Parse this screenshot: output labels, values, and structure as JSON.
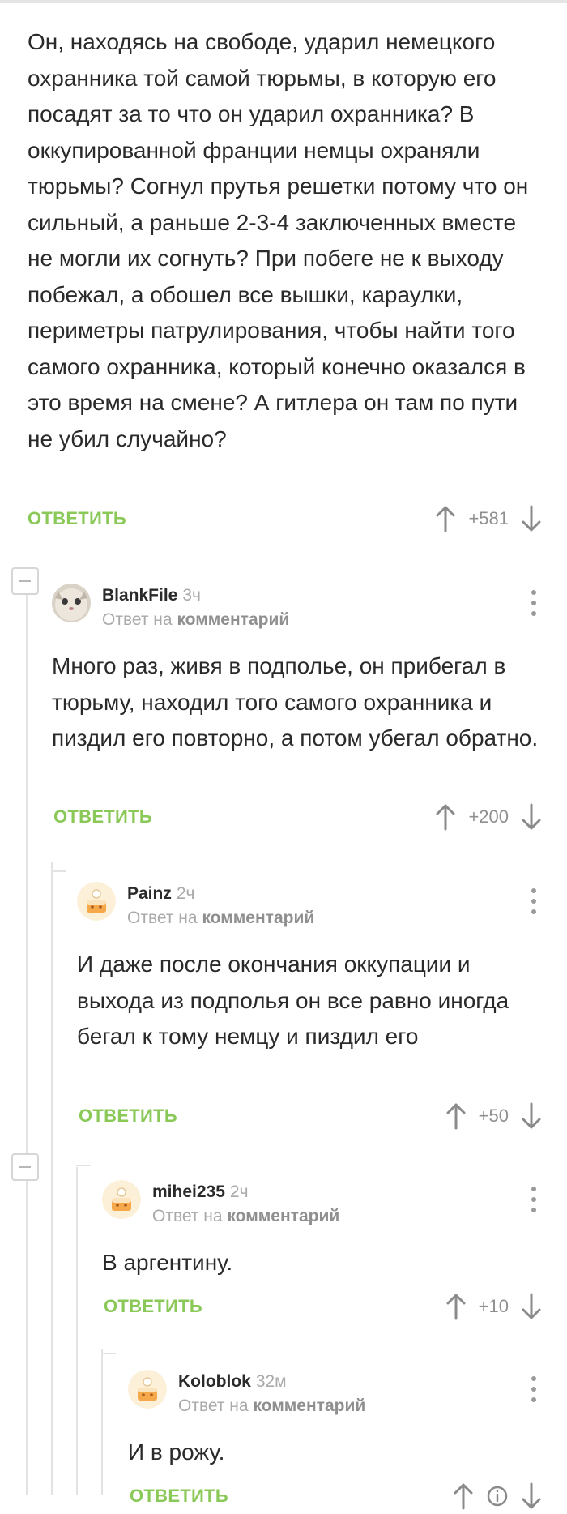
{
  "top_comment": {
    "text": "Он, находясь на свободе, ударил немецкого охранника той самой тюрьмы, в которую его посадят за то что он ударил охранника? В оккупированной франции немцы охраняли тюрьмы? Согнул прутья решетки потому что он сильный, а раньше 2-3-4 заключенных вместе не могли их согнуть? При побеге не к выходу побежал, а обошел все вышки, караулки, периметры патрулирования, чтобы найти того самого охранника, который конечно оказался в это время на смене? А гитлера он там по пути не убил случайно?",
    "reply_label": "ОТВЕТИТЬ",
    "score": "+581"
  },
  "comments": [
    {
      "username": "BlankFile",
      "time": "3ч",
      "reply_to_prefix": "Ответ на",
      "reply_to_target": "комментарий",
      "text": "Много раз, живя в подполье, он прибегал в тюрьму, находил того самого охранника и пиздил его повторно, а потом убегал обратно.",
      "reply_label": "ОТВЕТИТЬ",
      "score": "+200",
      "avatar": "cat-avatar"
    },
    {
      "username": "Painz",
      "time": "2ч",
      "reply_to_prefix": "Ответ на",
      "reply_to_target": "комментарий",
      "text": "И даже после окончания оккупации и выхода из подполья он все равно иногда бегал к тому немцу и пиздил его",
      "reply_label": "ОТВЕТИТЬ",
      "score": "+50",
      "avatar": "default-cake-avatar"
    },
    {
      "username": "mihei235",
      "time": "2ч",
      "reply_to_prefix": "Ответ на",
      "reply_to_target": "комментарий",
      "text": "В аргентину.",
      "reply_label": "ОТВЕТИТЬ",
      "score": "+10",
      "avatar": "default-cake-avatar"
    },
    {
      "username": "Koloblok",
      "time": "32м",
      "reply_to_prefix": "Ответ на",
      "reply_to_target": "комментарий",
      "text": "И в рожу.",
      "reply_label": "ОТВЕТИТЬ",
      "avatar": "default-cake-avatar"
    }
  ],
  "icons": {
    "upvote": "arrow-up-icon",
    "downvote": "arrow-down-icon",
    "more": "more-vertical-icon",
    "collapse": "collapse-thread-icon"
  },
  "colors": {
    "accent_green": "#8ac858",
    "meta_gray": "#a9a9a9",
    "text": "#2a2a2a"
  }
}
